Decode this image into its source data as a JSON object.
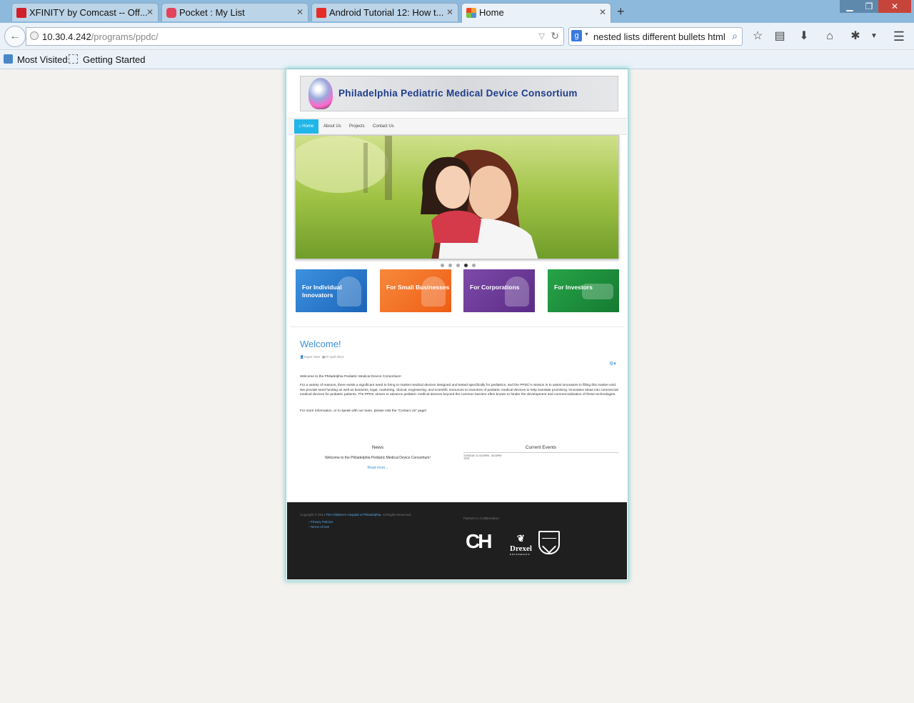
{
  "browser": {
    "tabs": [
      {
        "title": "XFINITY by Comcast -- Off...",
        "icon_color": "#d11f2a"
      },
      {
        "title": "Pocket : My List",
        "icon_color": "#e2445c"
      },
      {
        "title": "Android Tutorial 12: How t...",
        "icon_color": "#e52d27"
      },
      {
        "title": "Home",
        "icon_color": "#f4a12c"
      }
    ],
    "new_tab_label": "+",
    "url_host": "10.30.4.242",
    "url_path": "/programs/ppdc/",
    "search_query": "nested lists different bullets html",
    "bookmarks": [
      "Most Visited",
      "Getting Started"
    ]
  },
  "site": {
    "banner_title": "Philadelphia Pediatric Medical Device Consortium",
    "nav": [
      "Home",
      "About Us",
      "Projects",
      "Contact Us"
    ],
    "slider_active_index": 3,
    "tiles": [
      {
        "label": "For Individual Innovators",
        "color": "#2c7fd0"
      },
      {
        "label": "For Small Businesses",
        "color": "#f26f21"
      },
      {
        "label": "For Corporations",
        "color": "#6c3a96"
      },
      {
        "label": "For Investors",
        "color": "#1d8f3a"
      }
    ],
    "article": {
      "title": "Welcome!",
      "author": "Super User",
      "date": "07 April 2014",
      "intro": "Welcome to the Philadelphia Pediatric Medical Device Consortium!",
      "body": "For a variety of reasons, there exists a significant need to bring to market medical devices designed and tested specifically for pediatrics, and the PPDC's mission is to assist innovators in filling this market void. We provide seed funding as well as business, legal, marketing, clinical, engineering, and scientific resources to inventors of pediatric medical devices to help translate promising, innovative ideas into commercial medical devices for pediatric patients. The PPDC strives to advance pediatric medical devices beyond the common barriers often known to hinder the development and commercialization of these technologies.",
      "contact": "For more information, or to speak with our team, please visit the \"Contact Us\" page!"
    },
    "news": {
      "heading": "News",
      "item": "Welcome to the Philadelphia Pediatric Medical Device Consortium!",
      "read_more": "Read more..."
    },
    "events": {
      "heading": "Current Events",
      "line1": "TUESDAY 31 03:00PM - 05:30PM",
      "line2": "TEST"
    },
    "footer": {
      "copyright_prefix": "Copyright © 2014",
      "copyright_link": "The Children's Hospital of Philadelphia",
      "copyright_suffix": ". All Rights Reserved.",
      "links": [
        "Privacy Policies",
        "Terms of Use"
      ],
      "partners_label": "Partners in Collaboration:",
      "logos": [
        "CH",
        "Drexel",
        "UNIVERSITY"
      ]
    }
  }
}
